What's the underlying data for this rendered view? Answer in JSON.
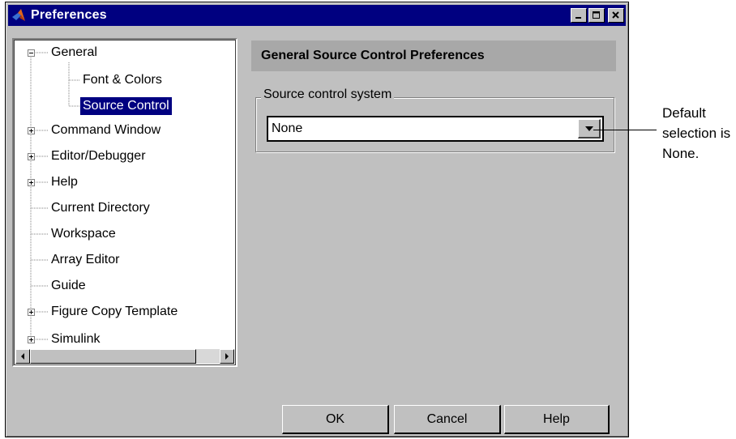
{
  "window": {
    "title": "Preferences",
    "controls": [
      "minimize",
      "maximize",
      "close"
    ]
  },
  "tree": {
    "items": [
      {
        "label": "General",
        "expander": "minus"
      },
      {
        "label": "Font & Colors"
      },
      {
        "label": "Source Control",
        "selected": true
      },
      {
        "label": "Command Window",
        "expander": "plus"
      },
      {
        "label": "Editor/Debugger",
        "expander": "plus"
      },
      {
        "label": "Help",
        "expander": "plus"
      },
      {
        "label": "Current Directory"
      },
      {
        "label": "Workspace"
      },
      {
        "label": "Array Editor"
      },
      {
        "label": "Guide"
      },
      {
        "label": "Figure Copy Template",
        "expander": "plus"
      },
      {
        "label": "Simulink",
        "expander": "plus"
      }
    ]
  },
  "panel": {
    "header": "General Source Control Preferences",
    "group_label": "Source control system",
    "dropdown_value": "None"
  },
  "buttons": {
    "ok": "OK",
    "cancel": "Cancel",
    "help": "Help"
  },
  "annotation": {
    "line1": "Default",
    "line2": "selection is",
    "line3": "None."
  },
  "colors": {
    "titlebar": "#000080",
    "selection": "#000080",
    "dialog_bg": "#c0c0c0",
    "header_bg": "#a8a8a8"
  }
}
